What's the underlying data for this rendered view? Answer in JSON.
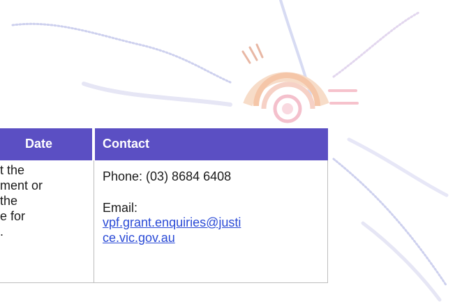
{
  "table": {
    "headers": {
      "date": "Date",
      "contact": "Contact"
    },
    "date_cell_lines": [
      "t the",
      "ment or",
      "the",
      "e for",
      "."
    ],
    "contact": {
      "phone": "Phone: (03) 8684 6408",
      "email_label": "Email:",
      "email_lines": [
        "vpf.grant.enquiries@justi",
        "ce.vic.gov.au"
      ]
    }
  },
  "colors": {
    "header_bg": "#5b4fc3",
    "link": "#2a4ad6",
    "motif_orange": "#f3b98d",
    "motif_pink": "#f6c2cc",
    "motif_lilac": "#cdd0ee"
  },
  "icons": [
    "aboriginal-sun-motif"
  ]
}
